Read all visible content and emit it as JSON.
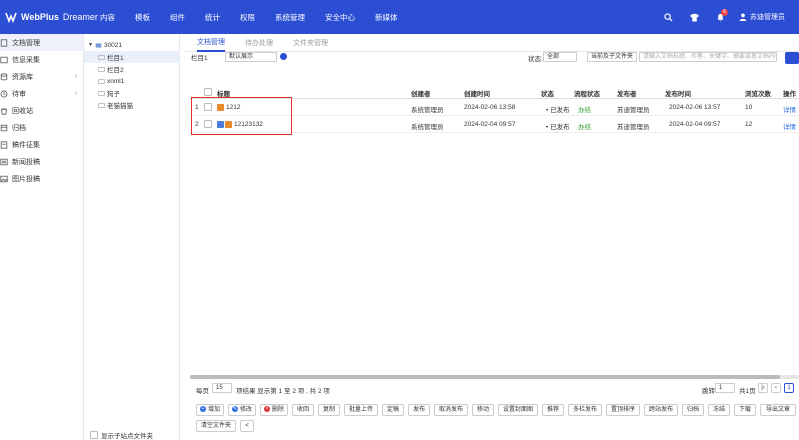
{
  "app": {
    "logo": "WebPlus",
    "logo_sub": "Dreamer"
  },
  "nav": [
    "内容",
    "模板",
    "组件",
    "统计",
    "权限",
    "系统管理",
    "安全中心",
    "新媒体"
  ],
  "header": {
    "notification_count": "6",
    "user": "苏迪管理员"
  },
  "sidebar": [
    {
      "label": "文档管理",
      "active": true
    },
    {
      "label": "信息采集"
    },
    {
      "label": "资源库",
      "chevron": true
    },
    {
      "label": "待审",
      "chevron": true
    },
    {
      "label": "回收站"
    },
    {
      "label": "归档"
    },
    {
      "label": "稿件征集"
    },
    {
      "label": "新闻投稿"
    },
    {
      "label": "图片投稿"
    }
  ],
  "tree": {
    "root": "30021",
    "children": [
      "栏目1",
      "栏目2",
      "xnml1",
      "狗子",
      "老猫猫猫"
    ],
    "footer": "显示子站点文件夹"
  },
  "tabs": [
    "文档管理",
    "待办处理",
    "文件夹管理"
  ],
  "filter": {
    "column": "栏目1",
    "display": "默认展示",
    "status_label": "状态:",
    "status_value": "全部",
    "scope": "当前及子文件夹",
    "search_placeholder": "请输入文档标题、作者、关键字、摘要或者文档内容"
  },
  "table": {
    "headers": [
      "标题",
      "创建者",
      "创建时间",
      "状态",
      "流程状态",
      "发布者",
      "发布时间",
      "浏览次数",
      "操作"
    ],
    "rows": [
      {
        "num": "1",
        "title": "1212",
        "creator": "系统管理员",
        "created": "2024-02-06 13:58",
        "status": "已发布",
        "flow": "办结",
        "publisher": "苏迪管理员",
        "published": "2024-02-06 13:57",
        "views": "10",
        "action": "详情"
      },
      {
        "num": "2",
        "title": "12123132",
        "creator": "系统管理员",
        "created": "2024-02-04 09:57",
        "status": "已发布",
        "flow": "办结",
        "publisher": "苏迪管理员",
        "published": "2024-02-04 09:57",
        "views": "12",
        "action": "详情"
      }
    ]
  },
  "pager": {
    "per_page_label": "每页",
    "per_page": "15",
    "summary": "项结果 显示第 1 至 2 项 , 共 2 项",
    "goto_label": "跳转",
    "goto_value": "1",
    "total_pages": "共1页",
    "current_page": "1"
  },
  "toolbar": {
    "row1": [
      "增加",
      "修改",
      "删除",
      "收回",
      "复制",
      "批量上传",
      "定稿",
      "发布",
      "取消发布",
      "移动",
      "设置封面图",
      "推荐",
      "多栏发布",
      "置顶排序",
      "跨站发布",
      "归档",
      "冻结",
      "下载",
      "导出文章"
    ],
    "row2": [
      "清空文件夹",
      "<"
    ]
  }
}
